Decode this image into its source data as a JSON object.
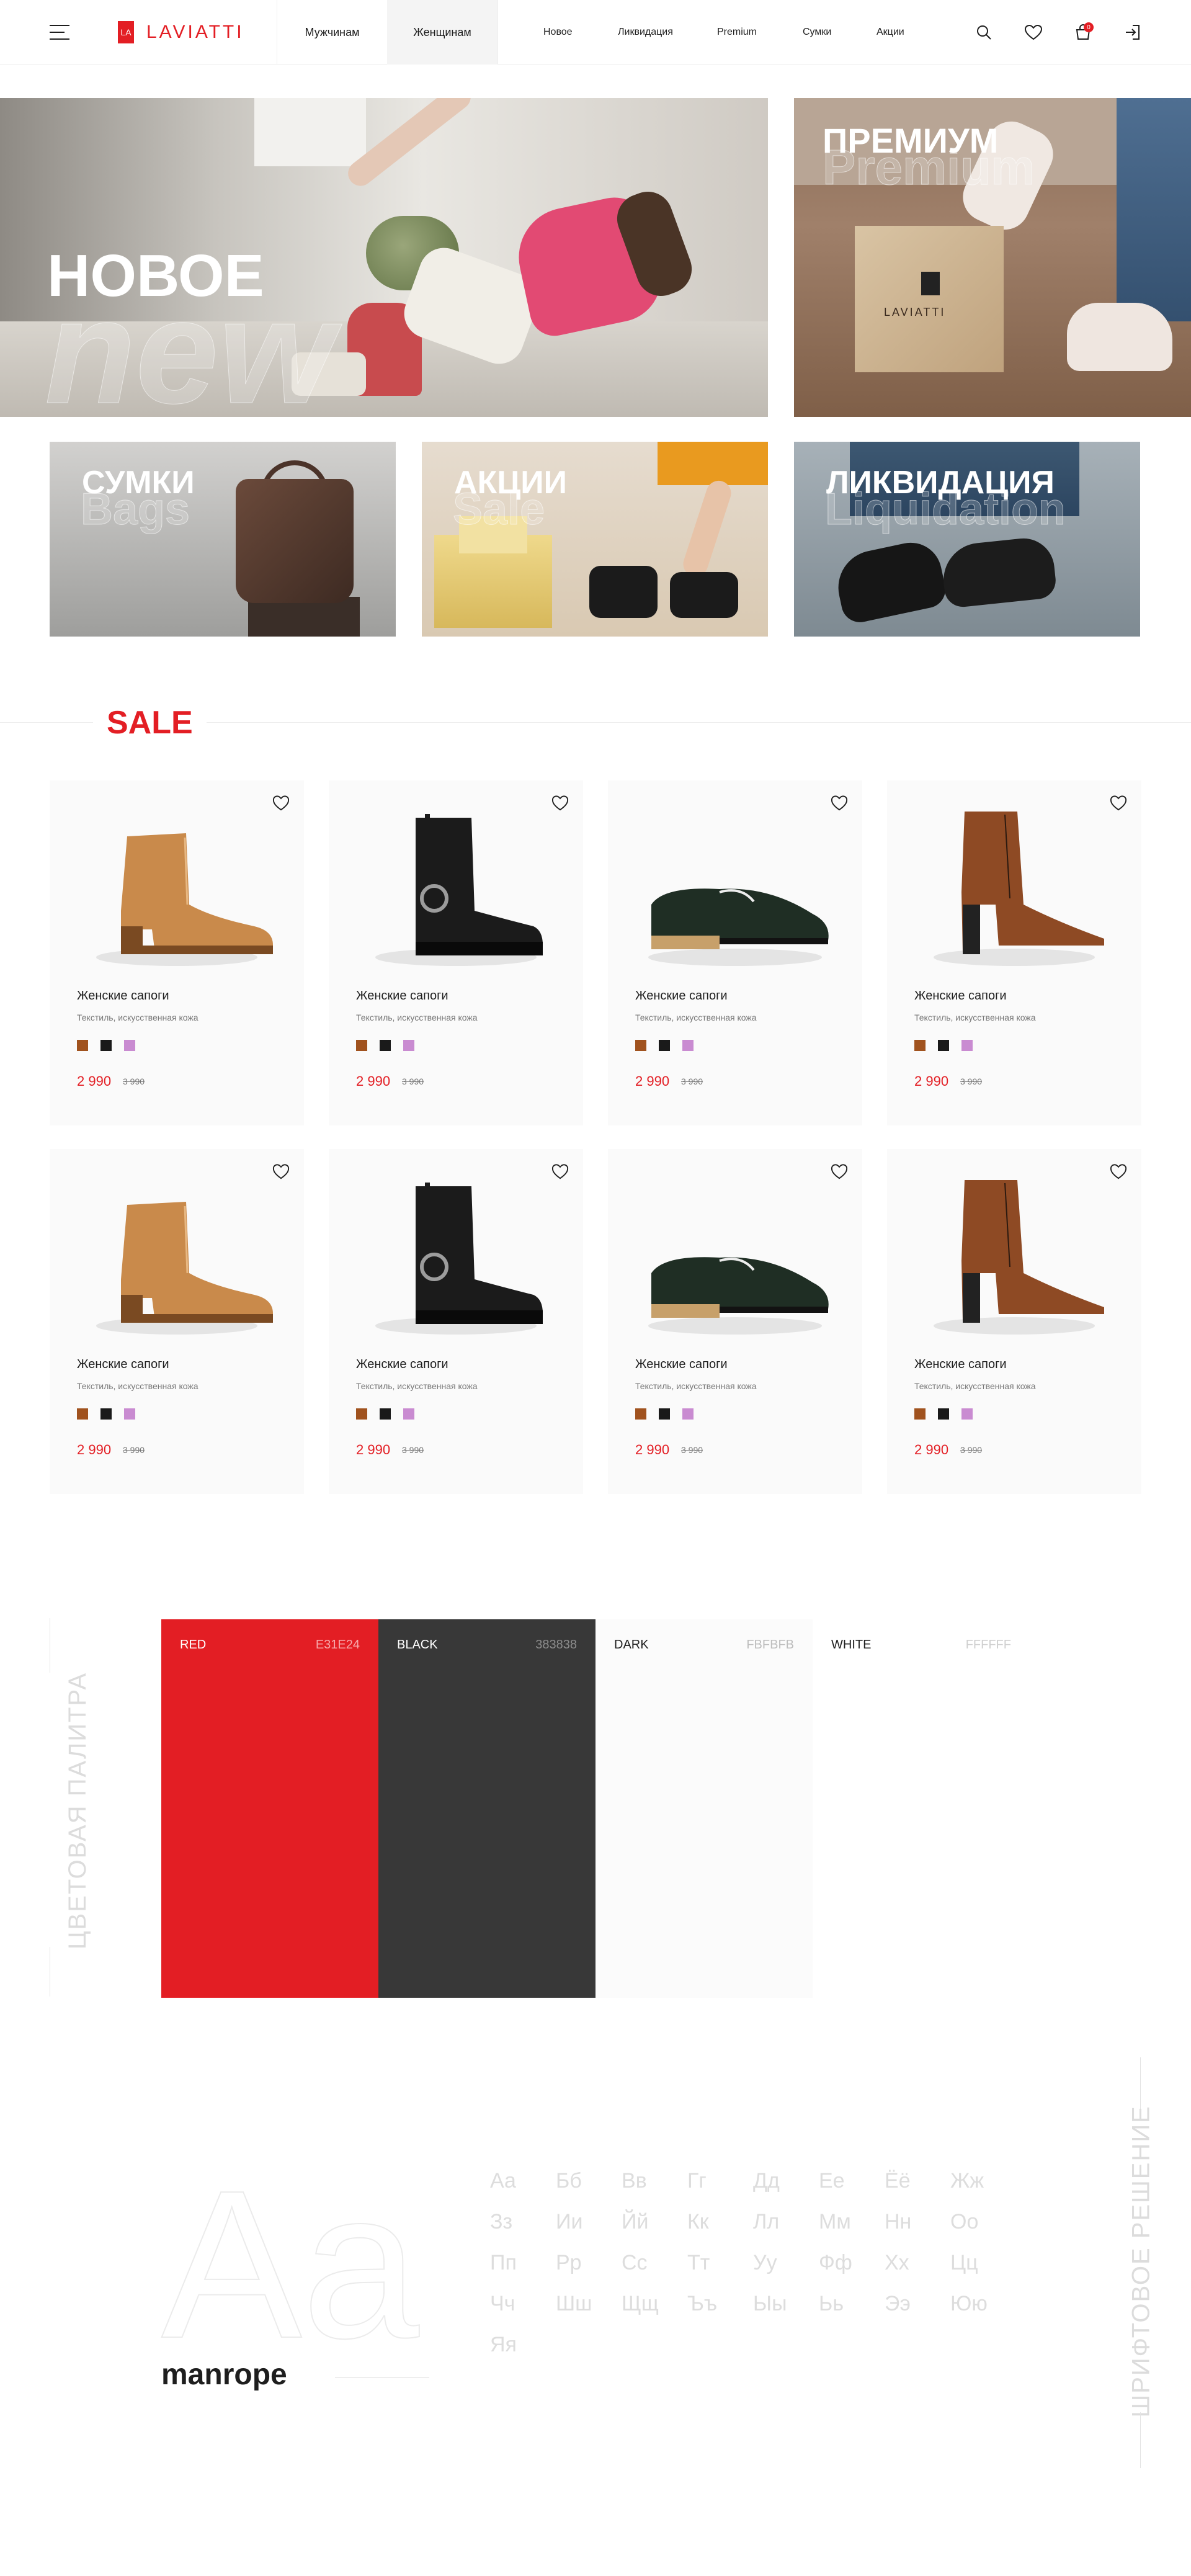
{
  "header": {
    "logo_mark": "LA",
    "logo_text": "LAVIATTI",
    "gender_tabs": [
      "Мужчинам",
      "Женщинам"
    ],
    "active_gender": "Женщинам",
    "nav": [
      "Новое",
      "Ликвидация",
      "Premium",
      "Сумки",
      "Акции"
    ],
    "cart_count": "0"
  },
  "banners": {
    "new": {
      "title": "НОВОЕ",
      "ghost": "new"
    },
    "premium": {
      "title": "ПРЕМИУМ",
      "ghost": "Premium",
      "box_label": "LAVIATTI",
      "box_mark": "LA"
    },
    "bags": {
      "title": "СУМКИ",
      "ghost": "Bags"
    },
    "sale": {
      "title": "АКЦИИ",
      "ghost": "Sale"
    },
    "liquidation": {
      "title": "ЛИКВИДАЦИЯ",
      "ghost": "Liquidation"
    }
  },
  "sale": {
    "heading": "SALE",
    "products": [
      {
        "name": "Женские сапоги",
        "desc": "Текстиль, искусственная кожа",
        "price": "2 990",
        "old_price": "3 990",
        "kind": "tan-chelsea"
      },
      {
        "name": "Женские сапоги",
        "desc": "Текстиль, искусственная кожа",
        "price": "2 990",
        "old_price": "3 990",
        "kind": "black-boot"
      },
      {
        "name": "Женские сапоги",
        "desc": "Текстиль, искусственная кожа",
        "price": "2 990",
        "old_price": "3 990",
        "kind": "green-loafer"
      },
      {
        "name": "Женские сапоги",
        "desc": "Текстиль, искусственная кожа",
        "price": "2 990",
        "old_price": "3 990",
        "kind": "brown-heel"
      },
      {
        "name": "Женские сапоги",
        "desc": "Текстиль, искусственная кожа",
        "price": "2 990",
        "old_price": "3 990",
        "kind": "tan-chelsea"
      },
      {
        "name": "Женские сапоги",
        "desc": "Текстиль, искусственная кожа",
        "price": "2 990",
        "old_price": "3 990",
        "kind": "black-boot"
      },
      {
        "name": "Женские сапоги",
        "desc": "Текстиль, искусственная кожа",
        "price": "2 990",
        "old_price": "3 990",
        "kind": "green-loafer"
      },
      {
        "name": "Женские сапоги",
        "desc": "Текстиль, искусственная кожа",
        "price": "2 990",
        "old_price": "3 990",
        "kind": "brown-heel"
      }
    ],
    "swatch_colors": [
      "#A0521E",
      "#1A1A1A",
      "#C98BD1"
    ]
  },
  "palette": {
    "label": "ЦВЕТОВАЯ ПАЛИТРА",
    "colors": [
      {
        "name": "RED",
        "hex": "E31E24"
      },
      {
        "name": "BLACK",
        "hex": "383838"
      },
      {
        "name": "DARK",
        "hex": "FBFBFB"
      },
      {
        "name": "WHITE",
        "hex": "FFFFFF"
      }
    ]
  },
  "font": {
    "label": "ШРИФТОВОЕ РЕШЕНИЕ",
    "sample": "Aa",
    "name": "manrope",
    "alphabet": [
      "Аа",
      "Бб",
      "Вв",
      "Гг",
      "Дд",
      "Ее",
      "Ёё",
      "Жж",
      "Зз",
      "Ии",
      "Йй",
      "Кк",
      "Лл",
      "Мм",
      "Нн",
      "Оо",
      "Пп",
      "Рр",
      "Сс",
      "Тт",
      "Уу",
      "Фф",
      "Хх",
      "Цц",
      "Чч",
      "Шш",
      "Щщ",
      "Ъъ",
      "Ыы",
      "Ьь",
      "Ээ",
      "Юю",
      "Яя"
    ]
  },
  "colors": {
    "accent": "#E31E24",
    "text": "#1E1E1E"
  }
}
